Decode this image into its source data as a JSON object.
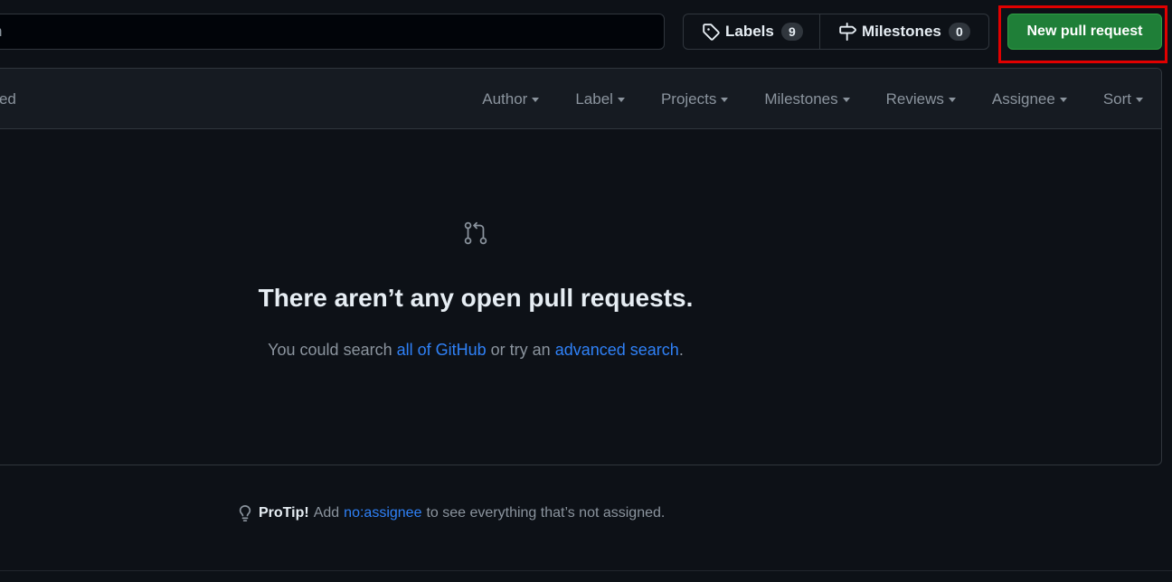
{
  "search": {
    "visible_text": "n"
  },
  "labels": {
    "label": "Labels",
    "count": "9"
  },
  "milestones": {
    "label": "Milestones",
    "count": "0"
  },
  "new_pr_button": {
    "label": "New pull request"
  },
  "tabs": {
    "closed_partial": "osed"
  },
  "filters": [
    "Author",
    "Label",
    "Projects",
    "Milestones",
    "Reviews",
    "Assignee",
    "Sort"
  ],
  "blankslate": {
    "icon": "git-pull-request-icon",
    "title": "There aren’t any open pull requests.",
    "text_before": "You could search",
    "link1": "all of GitHub",
    "text_mid": "or try an",
    "link2": "advanced search",
    "text_end": "."
  },
  "protip": {
    "icon": "light-bulb-icon",
    "label": "ProTip!",
    "text_before": "Add",
    "link": "no:assignee",
    "text_after": "to see everything that’s not assigned."
  },
  "colors": {
    "background": "#0d1117",
    "header": "#161b22",
    "border": "#30363d",
    "accent_green": "#1f7f38",
    "link": "#2f81f7",
    "muted": "#8b949e",
    "highlight": "#e00000"
  }
}
